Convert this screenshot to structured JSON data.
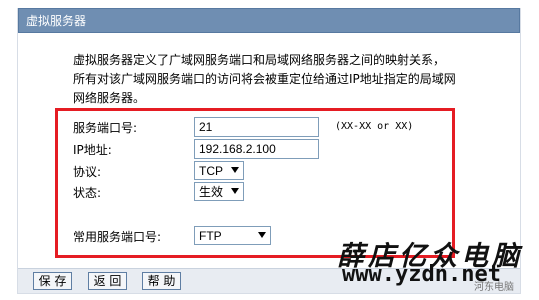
{
  "header": {
    "title": "虚拟服务器"
  },
  "description": {
    "line1": "虚拟服务器定义了广域网服务端口和局域网络服务器之间的映射关系，",
    "line2": "所有对该广域网服务端口的访问将会被重定位给通过IP地址指定的局域网",
    "line3": "网络服务器。"
  },
  "form": {
    "port_label": "服务端口号:",
    "port_value": "21",
    "port_hint": "(XX-XX or XX)",
    "ip_label": "IP地址:",
    "ip_value": "192.168.2.100",
    "protocol_label": "协议:",
    "protocol_value": "TCP",
    "status_label": "状态:",
    "status_value": "生效",
    "common_port_label": "常用服务端口号:",
    "common_port_value": "FTP"
  },
  "buttons": {
    "save": "保 存",
    "back": "返 回",
    "help": "帮 助"
  },
  "watermark": {
    "brand": "薛店亿众电脑",
    "url": "www.yzdn.net",
    "small": "河东电脑"
  },
  "colors": {
    "title_bar": "#6f8eb2",
    "highlight_box": "#e51c23",
    "button_bar": "#e8ecf2"
  }
}
